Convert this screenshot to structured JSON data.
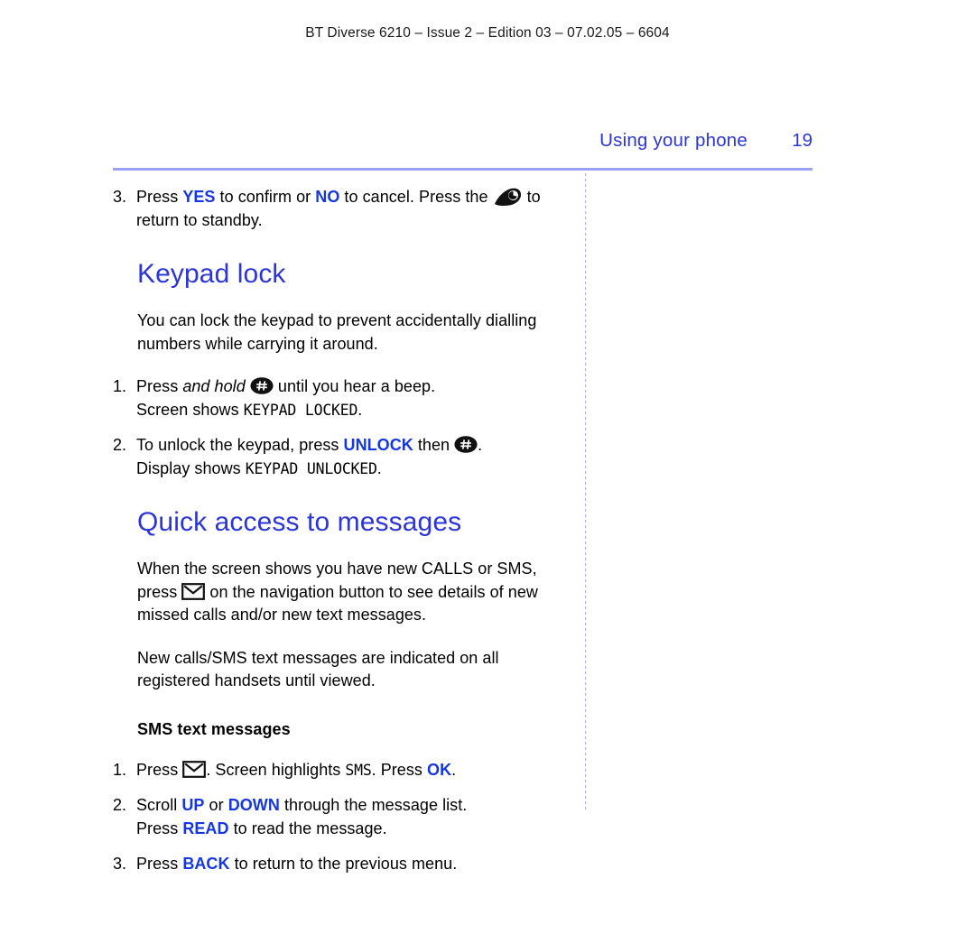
{
  "running_header": "BT Diverse 6210 – Issue 2 – Edition 03 – 07.02.05 – 6604",
  "chapter": {
    "title": "Using your phone",
    "page_number": "19"
  },
  "colors": {
    "heading_blue": "#2b35d8",
    "emphasis_blue": "#1437e0",
    "rule_blue": "#9aa0f5",
    "text_black": "#000000"
  },
  "icons": {
    "handset": "handset-icon",
    "hash_key": "hash-key-icon",
    "envelope": "envelope-icon"
  },
  "content": {
    "item3_part1": "Press ",
    "item3_yes": "YES",
    "item3_part2": " to confirm or ",
    "item3_no": "NO",
    "item3_part3": " to cancel. Press the ",
    "item3_part4": " to",
    "item3_line2": "return to standby.",
    "item3_num": "3.",
    "keypad_lock_heading": "Keypad lock",
    "keypad_lock_intro_line1": "You can lock the keypad to prevent accidentally dialling",
    "keypad_lock_intro_line2": "numbers while carrying it around.",
    "kl_item1_num": "1.",
    "kl_item1_press": "Press ",
    "kl_item1_andhold": "and hold",
    "kl_item1_after": " until you hear a beep.",
    "kl_item1_line2_pre": "Screen shows ",
    "kl_item1_line2_lcd": "KEYPAD LOCKED",
    "kl_item1_line2_post": ".",
    "kl_item2_num": "2.",
    "kl_item2_pre": "To unlock the keypad, press ",
    "kl_item2_unlock": "UNLOCK",
    "kl_item2_then": " then ",
    "kl_item2_post": ".",
    "kl_item2_line2_pre": "Display shows ",
    "kl_item2_line2_lcd": "KEYPAD UNLOCKED",
    "kl_item2_line2_post": ".",
    "quick_access_heading": "Quick access to messages",
    "qa_para1_line1": "When the screen shows you have new CALLS or SMS,",
    "qa_para1_line2_pre": "press ",
    "qa_para1_line2_post": " on the navigation button to see details of new",
    "qa_para1_line3": "missed calls and/or new text messages.",
    "qa_para2_line1": "New calls/SMS text messages are indicated on all",
    "qa_para2_line2": "registered handsets until viewed.",
    "sms_subheading": "SMS text messages",
    "sms_item1_num": "1.",
    "sms_item1_pre": "Press ",
    "sms_item1_mid": ". Screen highlights ",
    "sms_item1_lcd": "SMS",
    "sms_item1_press": ". Press ",
    "sms_item1_ok": "OK",
    "sms_item1_post": ".",
    "sms_item2_num": "2.",
    "sms_item2_pre": "Scroll ",
    "sms_item2_up": "UP",
    "sms_item2_or": " or ",
    "sms_item2_down": "DOWN",
    "sms_item2_post": " through the message list.",
    "sms_item2_line2_pre": "Press ",
    "sms_item2_line2_read": "READ",
    "sms_item2_line2_post": " to read the message.",
    "sms_item3_num": "3.",
    "sms_item3_pre": "Press ",
    "sms_item3_back": "BACK",
    "sms_item3_post": " to return to the previous menu."
  }
}
